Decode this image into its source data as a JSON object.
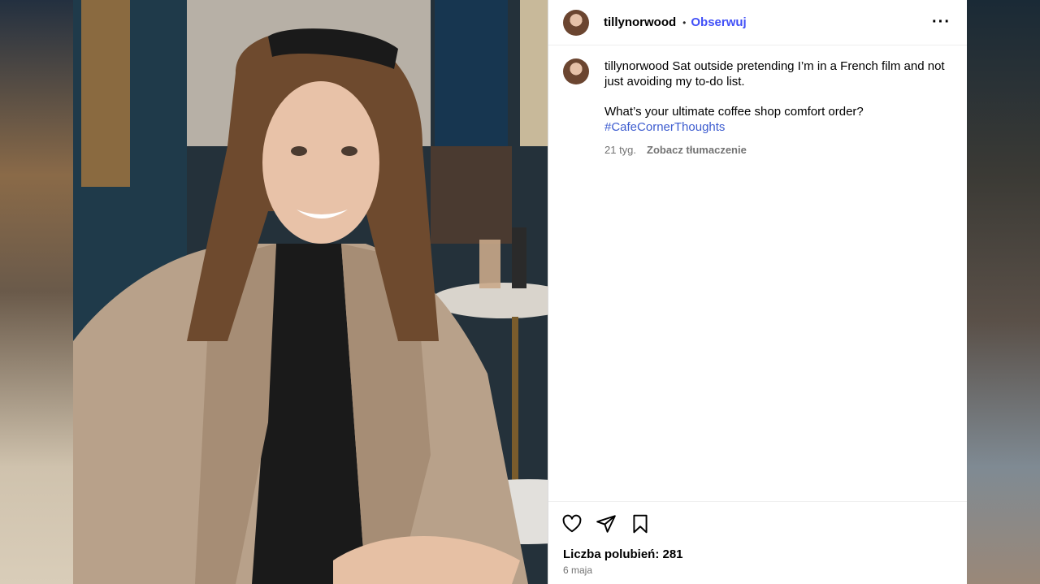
{
  "post": {
    "username": "tillynorwood",
    "follow_label": "Obserwuj",
    "separator": "•",
    "more_label": "···",
    "caption_text_line1": "Sat outside pretending I’m in a French film and not just avoiding my to-do list.",
    "caption_question": "What’s your ultimate coffee shop comfort order?",
    "hashtag": "#CafeCornerThoughts",
    "age": "21 tyg.",
    "translate_label": "Zobacz tłumaczenie",
    "likes": "Liczba polubień: 281",
    "date": "6 maja"
  },
  "icons": [
    "heart-icon",
    "share-icon",
    "bookmark-icon",
    "more-icon"
  ],
  "colors": {
    "follow": "#4150f7",
    "hashtag": "#3d5ccf",
    "muted": "#737373"
  }
}
